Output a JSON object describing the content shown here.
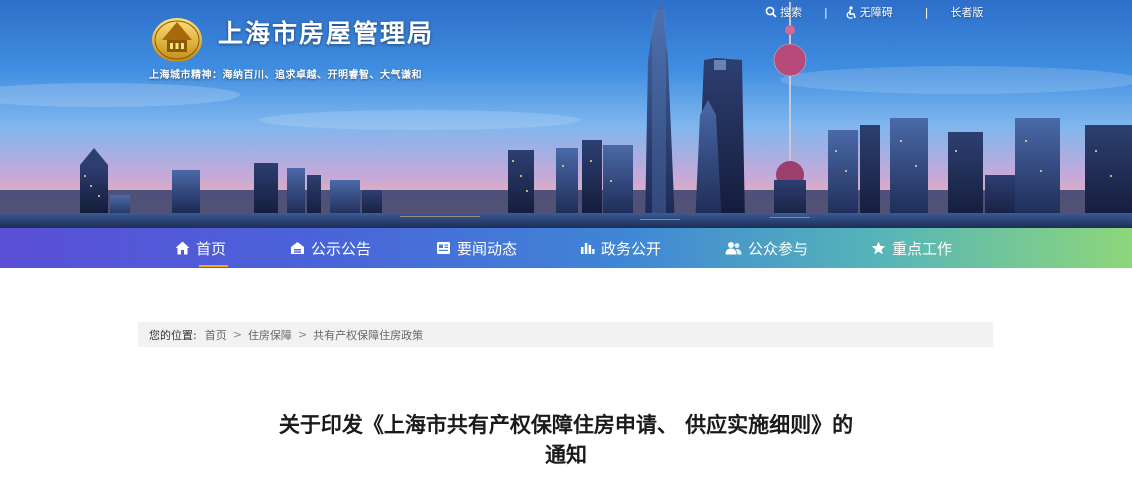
{
  "header": {
    "site_title": "上海市房屋管理局",
    "spirit_text": "上海城市精神：海纳百川、追求卓越、开明睿智、大气谦和",
    "links": {
      "search": "搜索",
      "accessibility": "无障碍",
      "elder": "长者版",
      "separator": "|"
    }
  },
  "nav": {
    "items": [
      {
        "label": "首页",
        "icon": "home-icon"
      },
      {
        "label": "公示公告",
        "icon": "notice-icon"
      },
      {
        "label": "要闻动态",
        "icon": "news-icon"
      },
      {
        "label": "政务公开",
        "icon": "chart-icon"
      },
      {
        "label": "公众参与",
        "icon": "users-icon"
      },
      {
        "label": "重点工作",
        "icon": "star-icon"
      }
    ],
    "active_index": 0
  },
  "breadcrumb": {
    "prefix": "您的位置:",
    "items": [
      "首页",
      "住房保障",
      "共有产权保障住房政策"
    ],
    "arrow": ">"
  },
  "article": {
    "title_line1": "关于印发《上海市共有产权保障住房申请、 供应实施细则》的",
    "title_line2": "通知"
  },
  "colors": {
    "nav_start": "#5a4fd6",
    "nav_end": "#8dd67a",
    "active_underline": "#f5a623"
  }
}
